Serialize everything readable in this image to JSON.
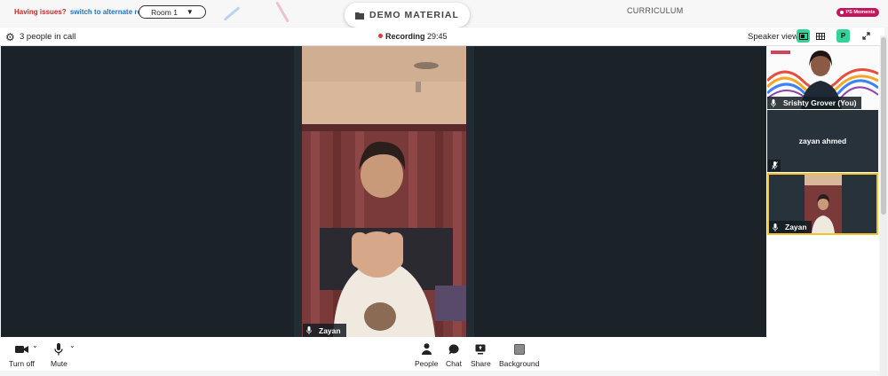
{
  "header": {
    "issues_label": "Having issues?",
    "alt_room_link": "switch to alternate room",
    "room_select": "Room 1",
    "demo_tab": "DEMO MATERIAL",
    "curriculum_tab": "CURRICULUM",
    "ps_moments": "PS Moments"
  },
  "callbar": {
    "people_count": "3 people in call",
    "recording_label": "Recording",
    "recording_time": "29:45",
    "speaker_view": "Speaker view",
    "p_button": "P"
  },
  "main_video": {
    "participant": "Zayan"
  },
  "sidebar": {
    "tiles": [
      {
        "name": "Srishty Grover (You)",
        "mic": "on"
      },
      {
        "name": "zayan ahmed",
        "mic": "off"
      },
      {
        "name": "Zayan",
        "mic": "on",
        "active_speaker": true
      }
    ]
  },
  "controls": {
    "turn_off": "Turn off",
    "mute": "Mute",
    "people": "People",
    "chat": "Chat",
    "share": "Share",
    "background": "Background"
  },
  "colors": {
    "accent_green": "#34d399",
    "recording_red": "#e53935",
    "active_border": "#f2c230",
    "issues_red": "#c62828",
    "link_blue": "#1e73be",
    "stage_bg": "#1b2329"
  }
}
